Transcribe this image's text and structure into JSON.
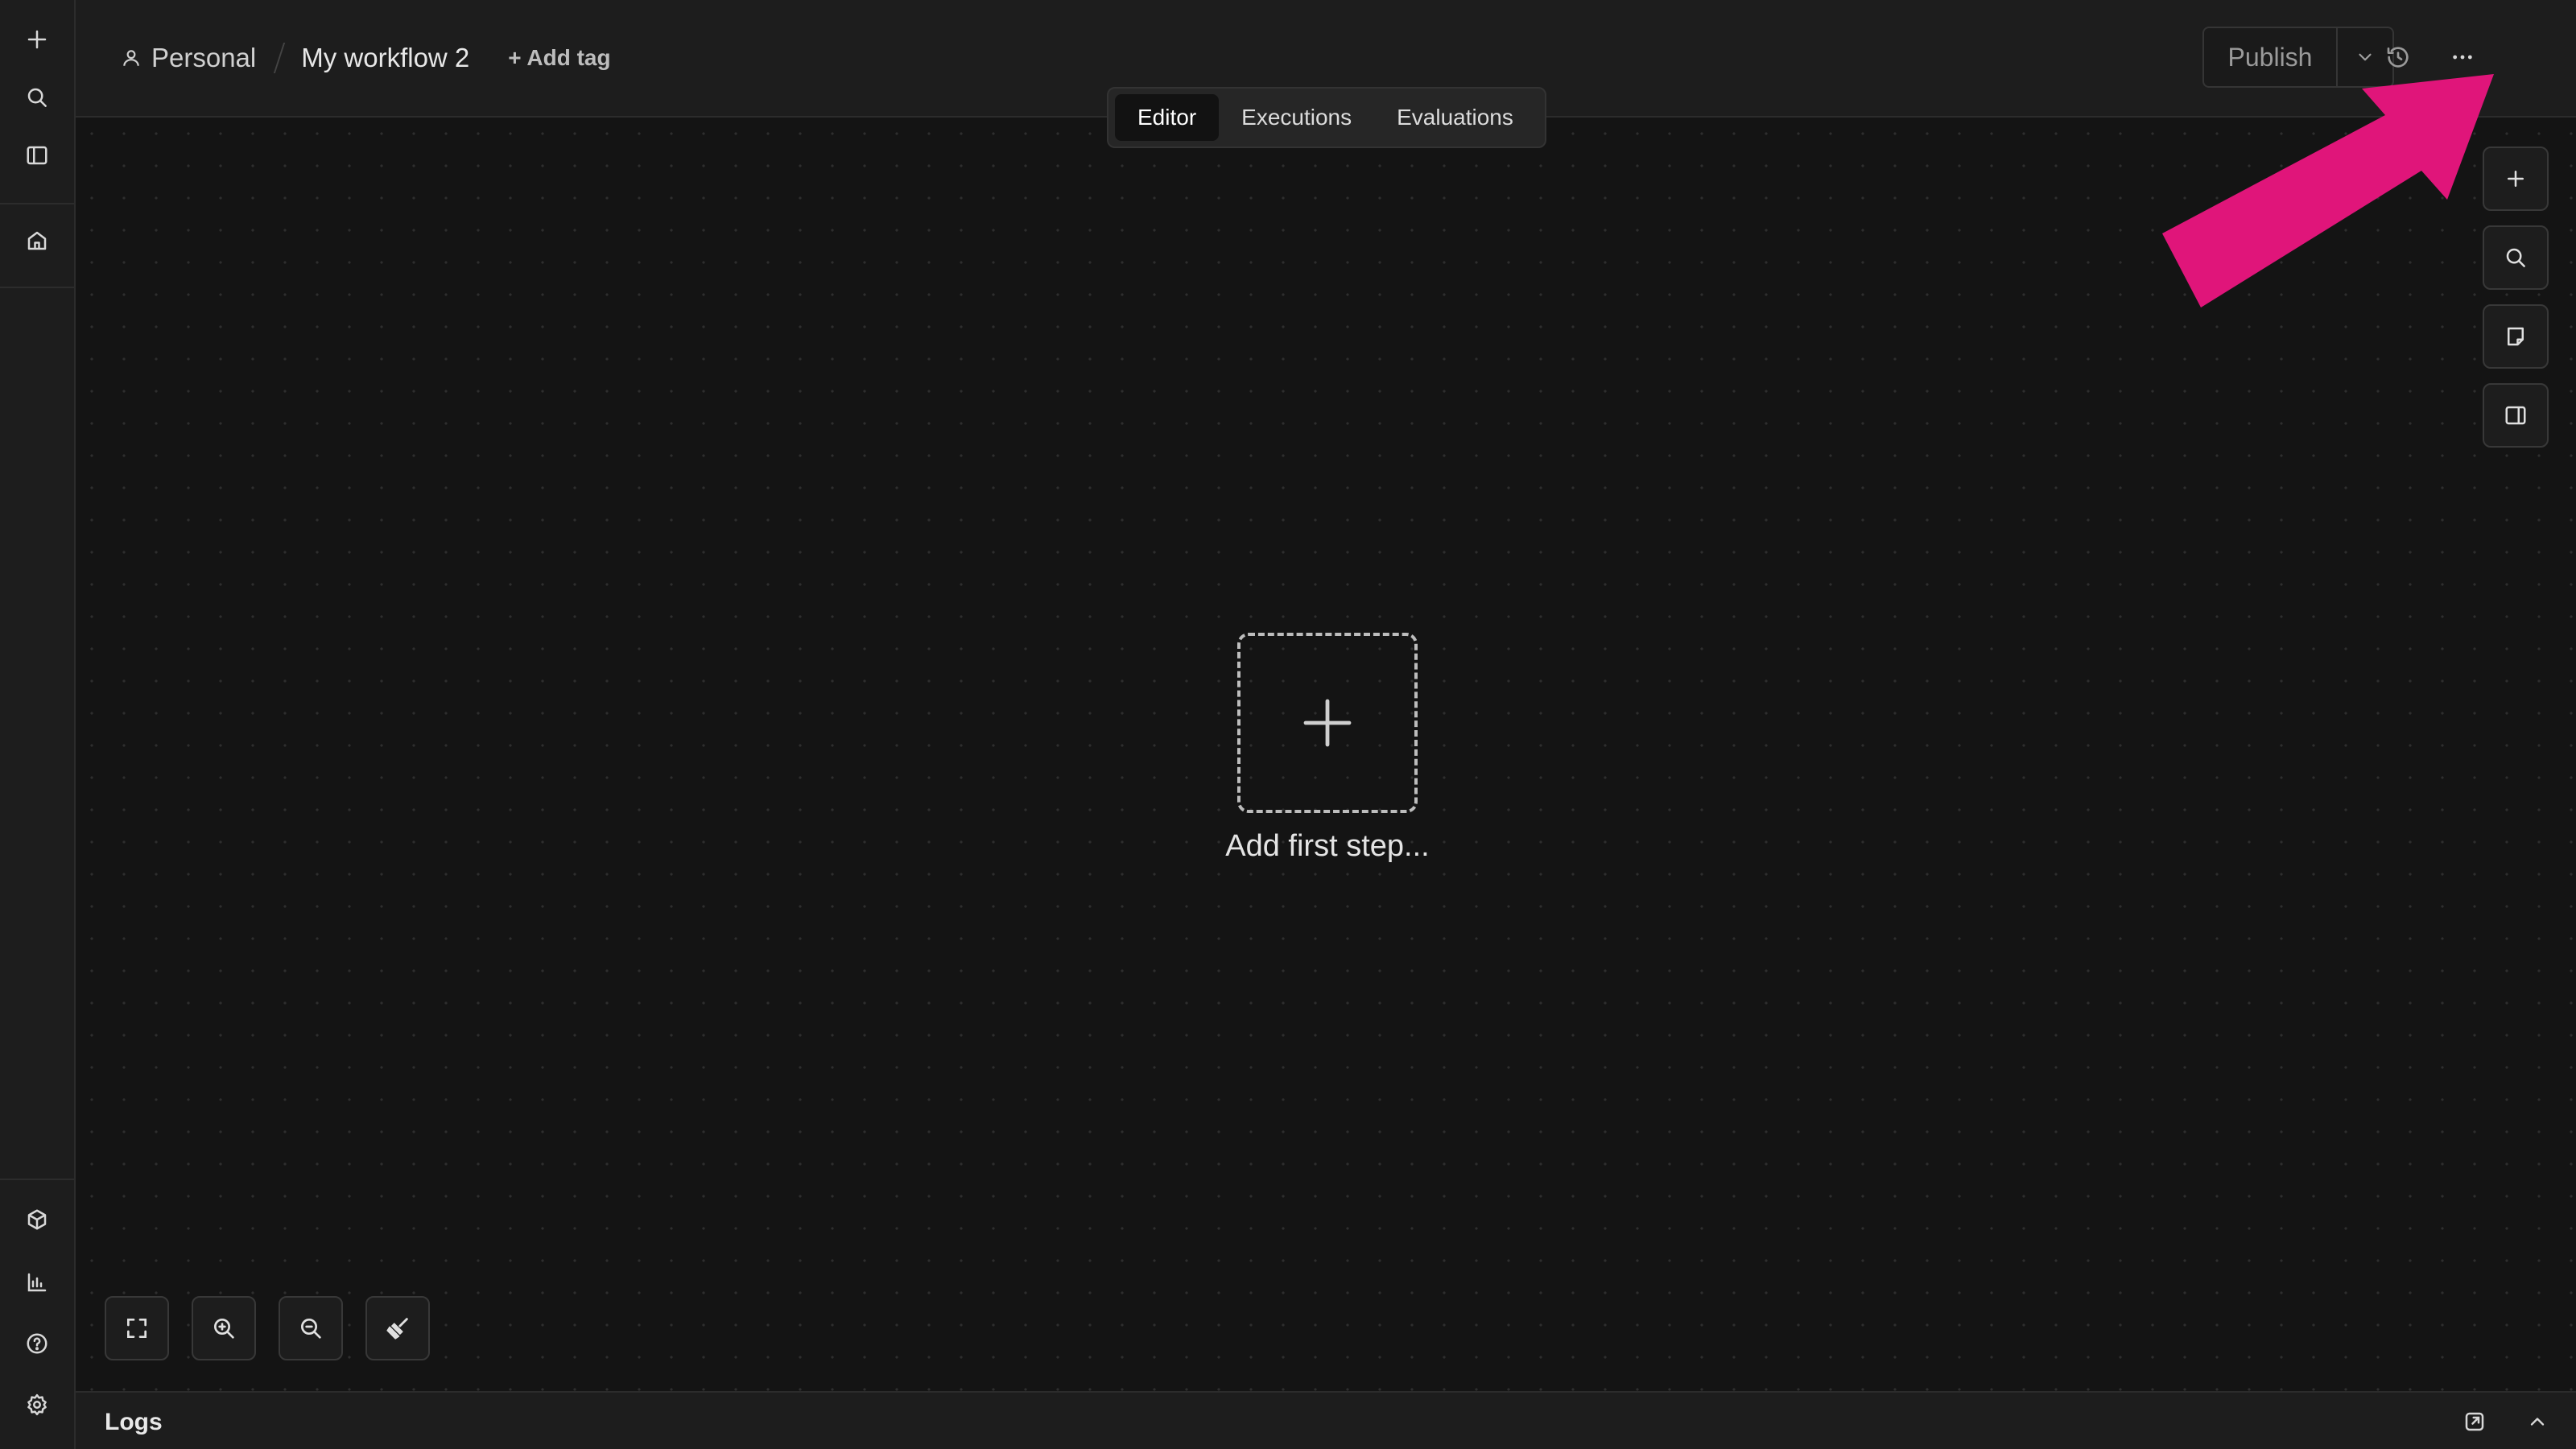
{
  "sidebar": {
    "top_items": [
      {
        "icon": "plus-icon"
      },
      {
        "icon": "search-icon"
      },
      {
        "icon": "panel-icon"
      },
      {
        "icon": "home-icon"
      }
    ],
    "bottom_items": [
      {
        "icon": "templates-icon"
      },
      {
        "icon": "insights-icon"
      },
      {
        "icon": "help-icon"
      },
      {
        "icon": "settings-icon"
      }
    ]
  },
  "header": {
    "project": "Personal",
    "workflow_title": "My workflow 2",
    "add_tag_label": "+ Add tag",
    "publish_label": "Publish"
  },
  "tabs": [
    {
      "label": "Editor",
      "active": true
    },
    {
      "label": "Executions",
      "active": false
    },
    {
      "label": "Evaluations",
      "active": false
    }
  ],
  "canvas": {
    "add_first_step_label": "Add first step..."
  },
  "logs": {
    "label": "Logs"
  },
  "colors": {
    "background": "#141414",
    "panel": "#1d1d1d",
    "annotation_arrow": "#e0157a"
  }
}
